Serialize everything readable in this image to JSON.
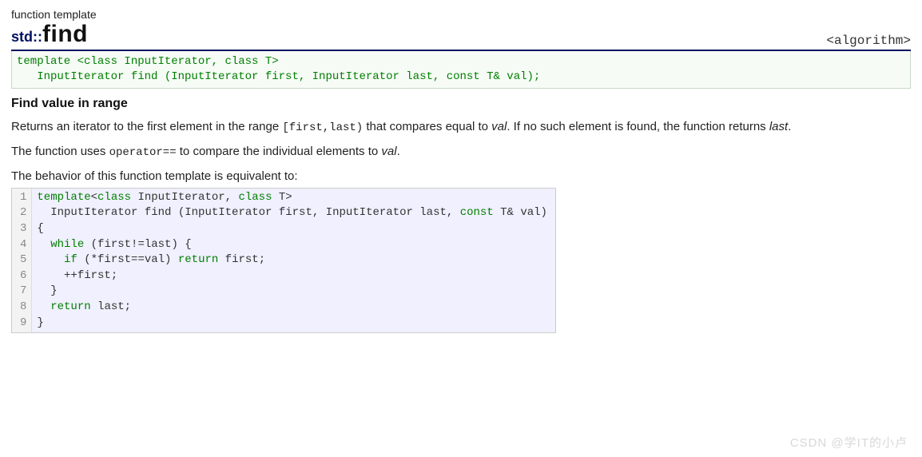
{
  "header": {
    "subtitle": "function template",
    "ns": "std::",
    "name": "find",
    "library": "<algorithm>"
  },
  "signature": {
    "line1_pre": "template <",
    "line1_kw1": "class",
    "line1_mid": " InputIterator, ",
    "line1_kw2": "class",
    "line1_post": " T>",
    "line2": "   InputIterator find (InputIterator first, InputIterator last, ",
    "line2_kw": "const",
    "line2_post": " T& val);"
  },
  "section_title": "Find value in range",
  "p1_a": "Returns an iterator to the first element in the range ",
  "p1_range": "[first,last)",
  "p1_b": " that compares equal to ",
  "p1_val": "val",
  "p1_c": ". If no such element is found, the function returns ",
  "p1_last": "last",
  "p1_d": ".",
  "p2_a": "The function uses ",
  "p2_op": "operator==",
  "p2_b": " to compare the individual elements to ",
  "p2_val": "val",
  "p2_c": ".",
  "p3": "The behavior of this function template is equivalent to:",
  "code": {
    "lines": [
      1,
      2,
      3,
      4,
      5,
      6,
      7,
      8,
      9
    ],
    "l1_a": "template",
    "l1_b": "<",
    "l1_c": "class",
    "l1_d": " InputIterator, ",
    "l1_e": "class",
    "l1_f": " T>",
    "l2_a": "  InputIterator find (InputIterator first, InputIterator last, ",
    "l2_b": "const",
    "l2_c": " T& val)",
    "l3": "{",
    "l4_a": "  ",
    "l4_b": "while",
    "l4_c": " (first!=last) {",
    "l5_a": "    ",
    "l5_b": "if",
    "l5_c": " (*first==val) ",
    "l5_d": "return",
    "l5_e": " first;",
    "l6": "    ++first;",
    "l7": "  }",
    "l8_a": "  ",
    "l8_b": "return",
    "l8_c": " last;",
    "l9": "}"
  },
  "watermark": "CSDN @学IT的小卢"
}
